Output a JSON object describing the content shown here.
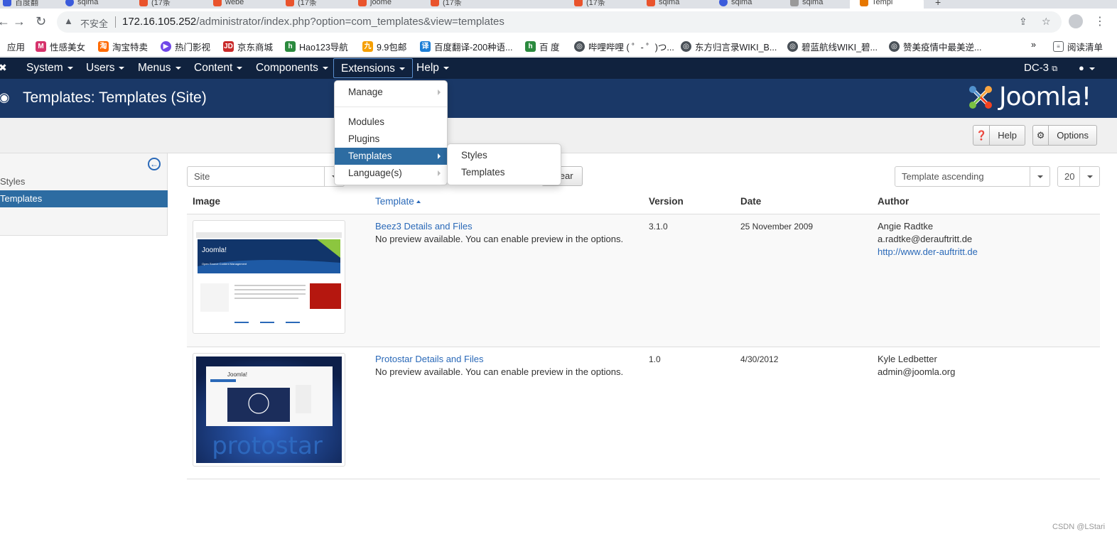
{
  "browser": {
    "tabs": [
      {
        "label": "百度翻",
        "icon": "baidu-icon"
      },
      {
        "label": "sqlma",
        "icon": "globe-icon"
      },
      {
        "label": "(17条",
        "icon": "csdn-icon"
      },
      {
        "label": "webe",
        "icon": "csdn-icon"
      },
      {
        "label": "(17条",
        "icon": "csdn-icon"
      },
      {
        "label": "joome",
        "icon": "csdn-icon"
      },
      {
        "label": "(17条",
        "icon": "csdn-icon"
      },
      {
        "label": "(17条",
        "icon": "csdn-icon"
      },
      {
        "label": "sqlma",
        "icon": "csdn-icon"
      },
      {
        "label": "sqlma",
        "icon": "globe-icon"
      },
      {
        "label": "sqlma",
        "icon": "globe-icon"
      },
      {
        "label": "Templ",
        "icon": "joomla-icon",
        "active": true
      }
    ],
    "insecure_label": "不安全",
    "url_host": "172.16.105.252",
    "url_path": "/administrator/index.php?option=com_templates&view=templates",
    "bookmarks": [
      {
        "label": "应用",
        "color": "#5f6368",
        "glyph": "▦"
      },
      {
        "label": "性感美女",
        "color": "#d6336c",
        "glyph": "M"
      },
      {
        "label": "淘宝特卖",
        "color": "#ff6a00",
        "glyph": "淘"
      },
      {
        "label": "热门影视",
        "color": "#7048e8",
        "glyph": "▶"
      },
      {
        "label": "京东商城",
        "color": "#c92a2a",
        "glyph": "JD"
      },
      {
        "label": "Hao123导航",
        "color": "#2b8a3e",
        "glyph": "h"
      },
      {
        "label": "9.9包邮",
        "color": "#f59f00",
        "glyph": "九"
      },
      {
        "label": "百度翻译-200种语...",
        "color": "#1c7ed6",
        "glyph": "译"
      },
      {
        "label": "百 度",
        "color": "#2b8a3e",
        "glyph": "h"
      },
      {
        "label": "哔哩哔哩 ( ゜- ゜)つ...",
        "color": "#495057",
        "glyph": "◎"
      },
      {
        "label": "东方归言录WIKI_B...",
        "color": "#495057",
        "glyph": "◎"
      },
      {
        "label": "碧蓝航线WIKI_碧...",
        "color": "#495057",
        "glyph": "◎"
      },
      {
        "label": "赞美疫情中最美逆...",
        "color": "#495057",
        "glyph": "◎"
      }
    ],
    "more_bookmarks": "»",
    "reading_list": "阅读清单"
  },
  "nav": {
    "menus": [
      "System",
      "Users",
      "Menus",
      "Content",
      "Components",
      "Extensions",
      "Help"
    ],
    "site_link": "DC-3"
  },
  "header": {
    "title": "Templates: Templates (Site)",
    "logo_text": "Joomla!"
  },
  "toolbar": {
    "help_label": "Help",
    "options_label": "Options"
  },
  "sidebar": {
    "items": [
      "Styles",
      "Templates"
    ]
  },
  "filters": {
    "client": "Site",
    "clear_label": "Clear",
    "ordering": "Template ascending",
    "limit": "20"
  },
  "table": {
    "headers": [
      "Image",
      "Template",
      "Version",
      "Date",
      "Author"
    ],
    "rows": [
      {
        "name": "Beez3 Details and Files",
        "note": "No preview available. You can enable preview in the options.",
        "version": "3.1.0",
        "date": "25 November 2009",
        "author": "Angie Radtke",
        "email": "a.radtke@derauftritt.de",
        "url": "http://www.der-auftritt.de"
      },
      {
        "name": "Protostar Details and Files",
        "note": "No preview available. You can enable preview in the options.",
        "version": "1.0",
        "date": "4/30/2012",
        "author": "Kyle Ledbetter",
        "email": "admin@joomla.org",
        "url": ""
      }
    ]
  },
  "extensions_menu": {
    "items": [
      "Manage",
      "Modules",
      "Plugins",
      "Templates",
      "Language(s)"
    ],
    "templates_submenu": [
      "Styles",
      "Templates"
    ]
  },
  "thumbs": {
    "beez_brand": "Joomla!",
    "beez_tagline": "Open Source Content Management",
    "protostar_brand": "Joomla!",
    "protostar_word": "protostar"
  },
  "watermark": "CSDN @LStari"
}
